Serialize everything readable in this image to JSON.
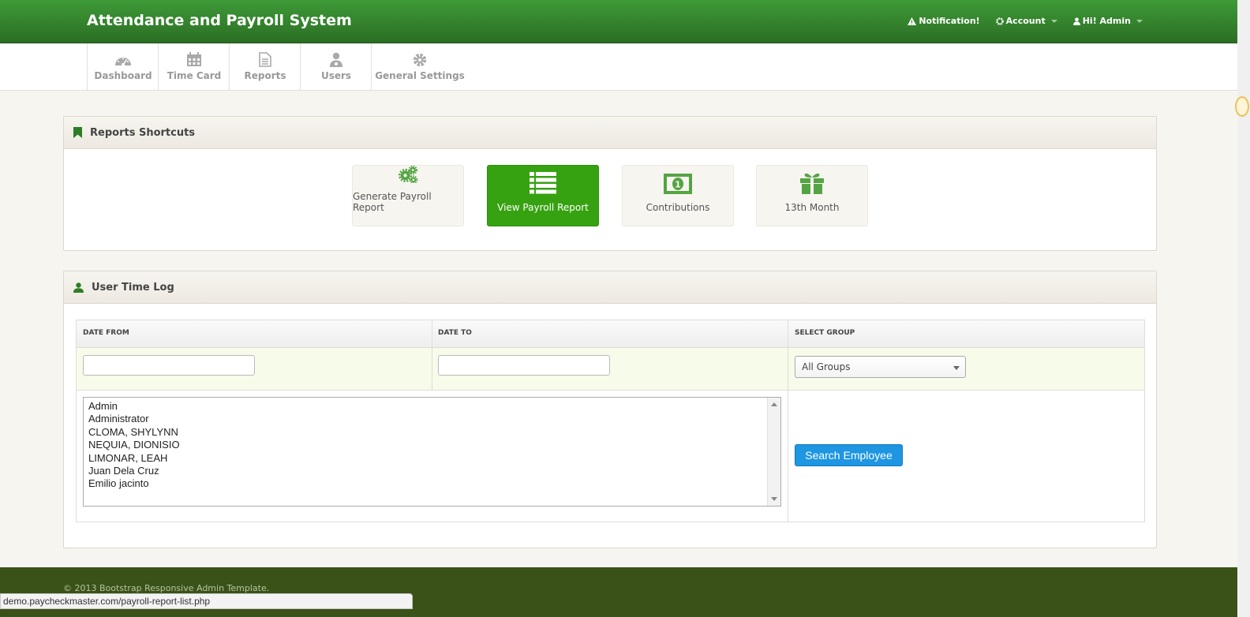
{
  "app": {
    "title": "Attendance and Payroll System"
  },
  "topnav": {
    "notification": "Notification!",
    "account": "Account",
    "user": "Hi! Admin"
  },
  "subnav": {
    "tabs": [
      {
        "label": "Dashboard",
        "icon": "dashboard-icon"
      },
      {
        "label": "Time Card",
        "icon": "calendar-icon"
      },
      {
        "label": "Reports",
        "icon": "document-icon"
      },
      {
        "label": "Users",
        "icon": "user-icon"
      },
      {
        "label": "General Settings",
        "icon": "gear-icon"
      }
    ]
  },
  "shortcuts": {
    "title": "Reports Shortcuts",
    "items": [
      {
        "label": "Generate Payroll Report",
        "icon": "gears-icon",
        "active": false
      },
      {
        "label": "View Payroll Report",
        "icon": "list-icon",
        "active": true
      },
      {
        "label": "Contributions",
        "icon": "money-icon",
        "active": false
      },
      {
        "label": "13th Month",
        "icon": "gift-icon",
        "active": false
      }
    ]
  },
  "timelog": {
    "title": "User Time Log",
    "date_from_label": "DATE FROM",
    "date_to_label": "DATE TO",
    "group_label": "SELECT GROUP",
    "date_from_value": "",
    "date_to_value": "",
    "group_value": "All Groups",
    "employees": [
      "Admin",
      "Administrator",
      "CLOMA, SHYLYNN",
      "NEQUIA, DIONISIO",
      "LIMONAR, LEAH",
      "Juan Dela Cruz",
      "Emilio jacinto"
    ],
    "search_label": "Search Employee"
  },
  "footer": {
    "copyright": "© 2013 Bootstrap Responsive Admin Template."
  },
  "statusbar": {
    "url": "demo.paycheckmaster.com/payroll-report-list.php"
  },
  "colors": {
    "brand_green": "#3e9a37",
    "active_shortcut": "#37a211",
    "search_button": "#1e96e2"
  }
}
